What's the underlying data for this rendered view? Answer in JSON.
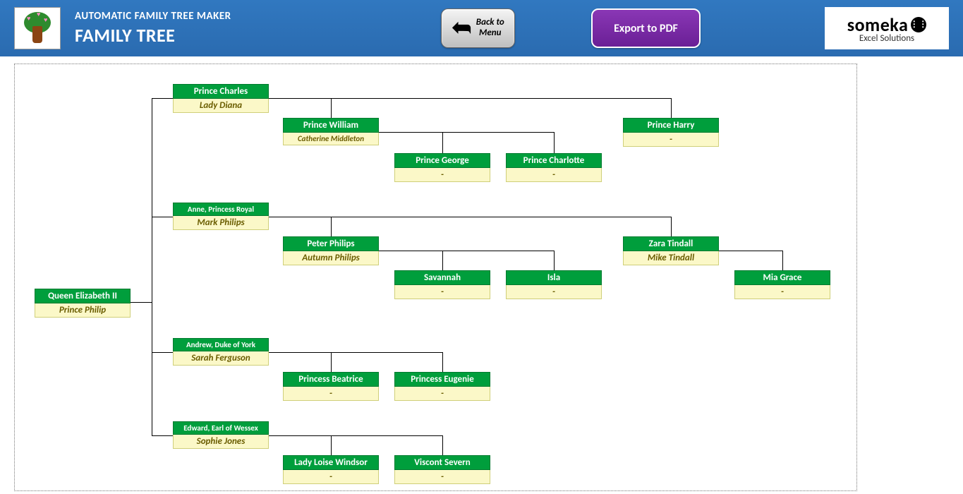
{
  "header": {
    "subtitle": "AUTOMATIC FAMILY TREE MAKER",
    "title": "FAMILY TREE",
    "back_label_1": "Back to",
    "back_label_2": "Menu",
    "export_label": "Export to PDF",
    "brand_main": "someka",
    "brand_sub": "Excel Solutions"
  },
  "tree": {
    "root": {
      "name": "Queen Elizabeth II",
      "spouse": "Prince Philip"
    },
    "c1": {
      "name": "Prince Charles",
      "spouse": "Lady Diana"
    },
    "c1a": {
      "name": "Prince William",
      "spouse": "Catherine Middleton"
    },
    "c1a1": {
      "name": "Prince George",
      "spouse": "-"
    },
    "c1a2": {
      "name": "Prince Charlotte",
      "spouse": "-"
    },
    "c1b": {
      "name": "Prince Harry",
      "spouse": "-"
    },
    "c2": {
      "name": "Anne, Princess Royal",
      "spouse": "Mark Philips"
    },
    "c2a": {
      "name": "Peter Philips",
      "spouse": "Autumn Philips"
    },
    "c2a1": {
      "name": "Savannah",
      "spouse": "-"
    },
    "c2a2": {
      "name": "Isla",
      "spouse": "-"
    },
    "c2b": {
      "name": "Zara Tindall",
      "spouse": "Mike Tindall"
    },
    "c2b1": {
      "name": "Mia Grace",
      "spouse": "-"
    },
    "c3": {
      "name": "Andrew, Duke of York",
      "spouse": "Sarah Ferguson"
    },
    "c3a": {
      "name": "Princess Beatrice",
      "spouse": "-"
    },
    "c3b": {
      "name": "Princess Eugenie",
      "spouse": "-"
    },
    "c4": {
      "name": "Edward, Earl of Wessex",
      "spouse": "Sophie Jones"
    },
    "c4a": {
      "name": "Lady Loise Windsor",
      "spouse": "-"
    },
    "c4b": {
      "name": "Viscont Severn",
      "spouse": "-"
    }
  }
}
